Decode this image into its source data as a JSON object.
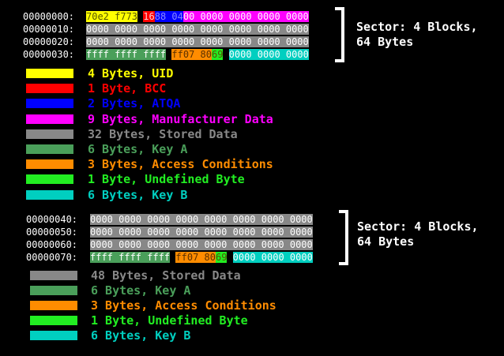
{
  "colors": {
    "uid": "#ffff00",
    "bcc": "#ff0000",
    "atqa": "#0000ff",
    "manufacturer": "#ff00ff",
    "stored": "#888888",
    "key_a": "#4a9f5a",
    "access": "#ff8c00",
    "undefined": "#22ee22",
    "key_b": "#00cfc0"
  },
  "sector0": {
    "label_line1": "Sector: 4 Blocks,",
    "label_line2": "64 Bytes",
    "rows": [
      {
        "address": "00000000:",
        "segments": [
          {
            "text": "70e2 f773",
            "type": "uid"
          },
          {
            "text": " ",
            "type": "gap"
          },
          {
            "text": "16",
            "type": "bcc"
          },
          {
            "text": "88 04",
            "type": "atqa"
          },
          {
            "text": "00 0000 0000 0000 0000",
            "type": "manufacturer"
          }
        ]
      },
      {
        "address": "00000010:",
        "segments": [
          {
            "text": "0000 0000 0000 0000 0000 0000 0000 0000",
            "type": "stored"
          }
        ]
      },
      {
        "address": "00000020:",
        "segments": [
          {
            "text": "0000 0000 0000 0000 0000 0000 0000 0000",
            "type": "stored"
          }
        ]
      },
      {
        "address": "00000030:",
        "segments": [
          {
            "text": "ffff ffff ffff",
            "type": "key_a"
          },
          {
            "text": " ",
            "type": "gap"
          },
          {
            "text": "ff07 80",
            "type": "access"
          },
          {
            "text": "69",
            "type": "undefined"
          },
          {
            "text": " ",
            "type": "gap"
          },
          {
            "text": "0000 0000 0000",
            "type": "key_b"
          }
        ]
      }
    ],
    "legend": [
      {
        "type": "uid",
        "text": "4 Bytes, UID"
      },
      {
        "type": "bcc",
        "text": "1 Byte, BCC"
      },
      {
        "type": "atqa",
        "text": "2 Bytes, ATQA"
      },
      {
        "type": "manufacturer",
        "text": "9 Bytes, Manufacturer Data"
      },
      {
        "type": "stored",
        "text": "32 Bytes, Stored Data"
      },
      {
        "type": "key_a",
        "text": "6 Bytes, Key A"
      },
      {
        "type": "access",
        "text": "3 Bytes, Access Conditions"
      },
      {
        "type": "undefined",
        "text": "1 Byte, Undefined Byte"
      },
      {
        "type": "key_b",
        "text": "6 Bytes, Key B"
      }
    ]
  },
  "sector1": {
    "label_line1": "Sector: 4 Blocks,",
    "label_line2": "64 Bytes",
    "rows": [
      {
        "address": "00000040:",
        "segments": [
          {
            "text": "0000 0000 0000 0000 0000 0000 0000 0000",
            "type": "stored"
          }
        ]
      },
      {
        "address": "00000050:",
        "segments": [
          {
            "text": "0000 0000 0000 0000 0000 0000 0000 0000",
            "type": "stored"
          }
        ]
      },
      {
        "address": "00000060:",
        "segments": [
          {
            "text": "0000 0000 0000 0000 0000 0000 0000 0000",
            "type": "stored"
          }
        ]
      },
      {
        "address": "00000070:",
        "segments": [
          {
            "text": "ffff ffff ffff",
            "type": "key_a"
          },
          {
            "text": " ",
            "type": "gap"
          },
          {
            "text": "ff07 80",
            "type": "access"
          },
          {
            "text": "69",
            "type": "undefined"
          },
          {
            "text": " ",
            "type": "gap"
          },
          {
            "text": "0000 0000 0000",
            "type": "key_b"
          }
        ]
      }
    ],
    "legend": [
      {
        "type": "stored",
        "text": "48 Bytes, Stored Data"
      },
      {
        "type": "key_a",
        "text": "6 Bytes, Key A"
      },
      {
        "type": "access",
        "text": "3 Bytes, Access Conditions"
      },
      {
        "type": "undefined",
        "text": "1 Byte, Undefined Byte"
      },
      {
        "type": "key_b",
        "text": "6 Bytes, Key B"
      }
    ]
  }
}
